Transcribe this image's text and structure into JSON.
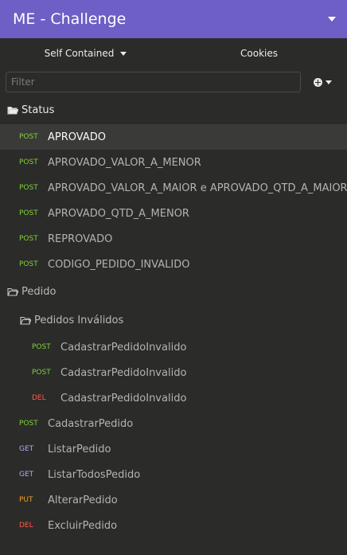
{
  "header": {
    "title": "ME - Challenge",
    "menu_icon": "chevron-down-icon"
  },
  "subbar": {
    "environment": "Self Contained",
    "cookies": "Cookies"
  },
  "filter": {
    "placeholder": "Filter",
    "value": ""
  },
  "tree": {
    "status_folder": {
      "name": "Status",
      "requests": [
        {
          "method": "POST",
          "name": "APROVADO",
          "active": true
        },
        {
          "method": "POST",
          "name": "APROVADO_VALOR_A_MENOR"
        },
        {
          "method": "POST",
          "name": "APROVADO_VALOR_A_MAIOR e APROVADO_QTD_A_MAIOR"
        },
        {
          "method": "POST",
          "name": "APROVADO_QTD_A_MENOR"
        },
        {
          "method": "POST",
          "name": "REPROVADO"
        },
        {
          "method": "POST",
          "name": "CODIGO_PEDIDO_INVALIDO"
        }
      ]
    },
    "pedido_folder": {
      "name": "Pedido",
      "subfolder": {
        "name": "Pedidos Inválidos",
        "requests": [
          {
            "method": "POST",
            "name": "CadastrarPedidoInvalido"
          },
          {
            "method": "POST",
            "name": "CadastrarPedidoInvalido"
          },
          {
            "method": "DEL",
            "name": "CadastrarPedidoInvalido"
          }
        ]
      },
      "requests": [
        {
          "method": "POST",
          "name": "CadastrarPedido"
        },
        {
          "method": "GET",
          "name": "ListarPedido"
        },
        {
          "method": "GET",
          "name": "ListarTodosPedido"
        },
        {
          "method": "PUT",
          "name": "AlterarPedido"
        },
        {
          "method": "DEL",
          "name": "ExcluirPedido"
        }
      ]
    }
  },
  "colors": {
    "header": "#6d5fc5",
    "POST": "#7fd03a",
    "GET": "#b4a7ff",
    "PUT": "#ff9a1f",
    "DEL": "#ff5b4a"
  }
}
